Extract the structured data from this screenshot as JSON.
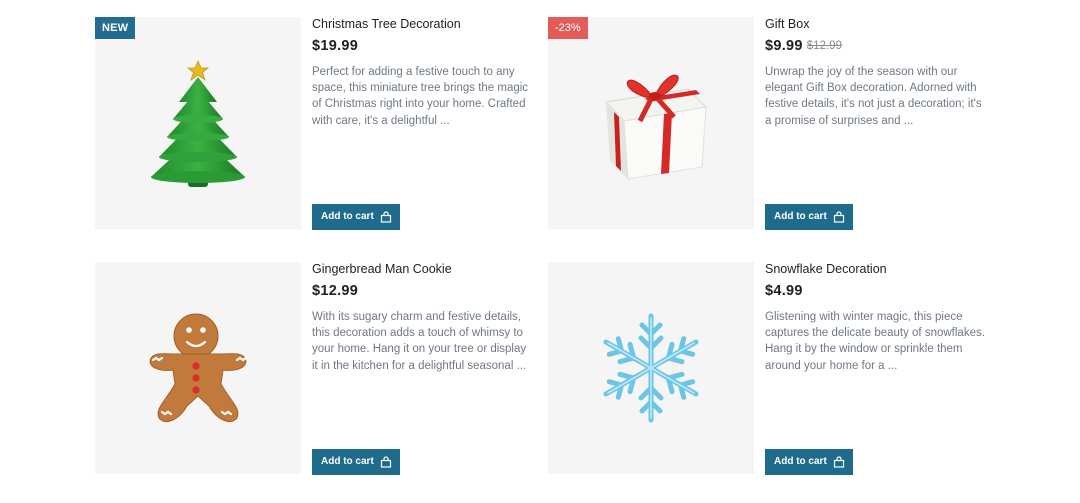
{
  "products": [
    {
      "badge": "NEW",
      "title": "Christmas Tree Decoration",
      "price": "$19.99",
      "description": "Perfect for adding a festive touch to any space, this miniature tree brings the magic of Christmas right into your home. Crafted with care, it's a delightful ...",
      "button_label": "Add to cart",
      "image_icon": "christmas-tree-icon"
    },
    {
      "badge": "-23%",
      "title": "Gift Box",
      "price": "$9.99",
      "old_price": "$12.99",
      "description": "Unwrap the joy of the season with our elegant Gift Box decoration. Adorned with festive details, it's not just a decoration; it's a promise of surprises and ...",
      "button_label": "Add to cart",
      "image_icon": "gift-box-icon"
    },
    {
      "title": "Gingerbread Man Cookie",
      "price": "$12.99",
      "description": "With its sugary charm and festive details, this decoration adds a touch of whimsy to your home. Hang it on your tree or display it in the kitchen for a delightful seasonal ...",
      "button_label": "Add to cart",
      "image_icon": "gingerbread-man-icon"
    },
    {
      "title": "Snowflake Decoration",
      "price": "$4.99",
      "description": "Glistening with winter magic, this piece captures the delicate beauty of snowflakes. Hang it by the window or sprinkle them around your home for a ...",
      "button_label": "Add to cart",
      "image_icon": "snowflake-icon"
    }
  ],
  "colors": {
    "accent": "#1e6b8c",
    "new_badge": "#236c8f",
    "sale_badge": "#e25c5a",
    "image_bg": "#f5f5f6"
  }
}
